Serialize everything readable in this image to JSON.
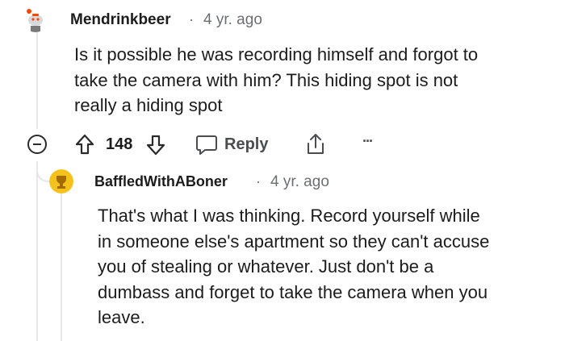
{
  "comments": [
    {
      "username": "Mendrinkbeer",
      "separator": "·",
      "age": "4 yr. ago",
      "body_lines": [
        "Is it possible he was recording himself and forgot to",
        "take the camera with him? This hiding spot is not",
        "really a hiding spot"
      ],
      "votes": "148",
      "reply_label": "Reply",
      "more_label": "···"
    },
    {
      "username": "BaffledWithABoner",
      "separator": "·",
      "age": "4 yr. ago",
      "body_lines": [
        "That's what I was thinking. Record yourself while",
        "in someone else's apartment so they can't accuse",
        "you of stealing or whatever. Just don't be a",
        "dumbass and forget to take the camera when you",
        "leave."
      ]
    }
  ],
  "colors": {
    "text": "#1c1c1c",
    "meta": "#6b6f73",
    "thread_line": "#e5e7e9",
    "snoo_orange": "#ff4500",
    "avatar_yellow": "#f5c21b"
  },
  "icons": [
    "snoo-avatar-icon",
    "collapse-icon",
    "upvote-icon",
    "downvote-icon",
    "reply-icon",
    "share-icon",
    "more-icon",
    "trophy-avatar-icon"
  ]
}
